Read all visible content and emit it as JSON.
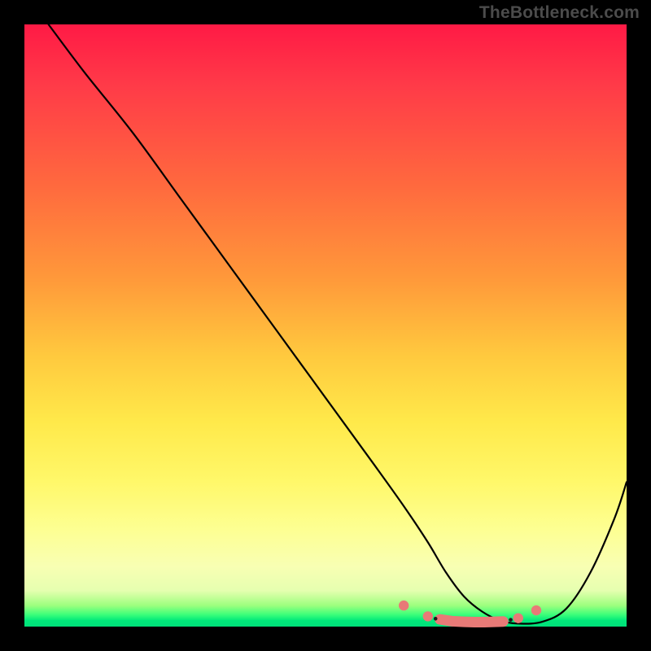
{
  "watermark": "TheBottleneck.com",
  "gradient_colors": {
    "top": "#ff1a45",
    "mid_upper": "#ff983a",
    "mid": "#ffe94a",
    "lower": "#f8ffb3",
    "bottom": "#00e07a"
  },
  "chart_data": {
    "type": "line",
    "title": "",
    "xlabel": "",
    "ylabel": "",
    "xlim": [
      0,
      100
    ],
    "ylim": [
      0,
      100
    ],
    "series": [
      {
        "name": "bottleneck-curve",
        "x": [
          4,
          10,
          18,
          26,
          34,
          42,
          50,
          58,
          63,
          67,
          70,
          73,
          76,
          79,
          82,
          86,
          90,
          94,
          98,
          100
        ],
        "values": [
          100,
          92,
          82,
          71,
          60,
          49,
          38,
          27,
          20,
          14,
          9,
          5,
          2.5,
          1,
          0.5,
          0.8,
          3,
          9,
          18,
          24
        ]
      }
    ],
    "markers": {
      "name": "highlight-points",
      "x": [
        63,
        67,
        69,
        71,
        73,
        74.7,
        76.4,
        78,
        79.5,
        82,
        85
      ],
      "values": [
        3.5,
        1.7,
        1.2,
        0.9,
        0.8,
        0.75,
        0.75,
        0.8,
        0.85,
        1.4,
        2.7
      ]
    }
  }
}
